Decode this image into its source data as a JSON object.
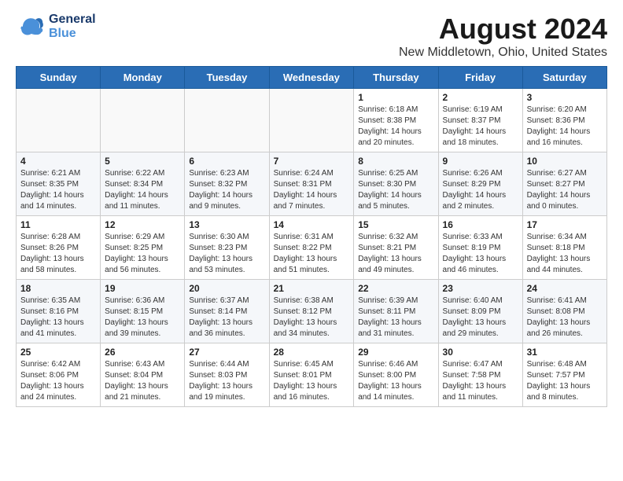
{
  "logo": {
    "line1": "General",
    "line2": "Blue"
  },
  "title": "August 2024",
  "subtitle": "New Middletown, Ohio, United States",
  "days_of_week": [
    "Sunday",
    "Monday",
    "Tuesday",
    "Wednesday",
    "Thursday",
    "Friday",
    "Saturday"
  ],
  "weeks": [
    [
      {
        "day": "",
        "info": ""
      },
      {
        "day": "",
        "info": ""
      },
      {
        "day": "",
        "info": ""
      },
      {
        "day": "",
        "info": ""
      },
      {
        "day": "1",
        "info": "Sunrise: 6:18 AM\nSunset: 8:38 PM\nDaylight: 14 hours\nand 20 minutes."
      },
      {
        "day": "2",
        "info": "Sunrise: 6:19 AM\nSunset: 8:37 PM\nDaylight: 14 hours\nand 18 minutes."
      },
      {
        "day": "3",
        "info": "Sunrise: 6:20 AM\nSunset: 8:36 PM\nDaylight: 14 hours\nand 16 minutes."
      }
    ],
    [
      {
        "day": "4",
        "info": "Sunrise: 6:21 AM\nSunset: 8:35 PM\nDaylight: 14 hours\nand 14 minutes."
      },
      {
        "day": "5",
        "info": "Sunrise: 6:22 AM\nSunset: 8:34 PM\nDaylight: 14 hours\nand 11 minutes."
      },
      {
        "day": "6",
        "info": "Sunrise: 6:23 AM\nSunset: 8:32 PM\nDaylight: 14 hours\nand 9 minutes."
      },
      {
        "day": "7",
        "info": "Sunrise: 6:24 AM\nSunset: 8:31 PM\nDaylight: 14 hours\nand 7 minutes."
      },
      {
        "day": "8",
        "info": "Sunrise: 6:25 AM\nSunset: 8:30 PM\nDaylight: 14 hours\nand 5 minutes."
      },
      {
        "day": "9",
        "info": "Sunrise: 6:26 AM\nSunset: 8:29 PM\nDaylight: 14 hours\nand 2 minutes."
      },
      {
        "day": "10",
        "info": "Sunrise: 6:27 AM\nSunset: 8:27 PM\nDaylight: 14 hours\nand 0 minutes."
      }
    ],
    [
      {
        "day": "11",
        "info": "Sunrise: 6:28 AM\nSunset: 8:26 PM\nDaylight: 13 hours\nand 58 minutes."
      },
      {
        "day": "12",
        "info": "Sunrise: 6:29 AM\nSunset: 8:25 PM\nDaylight: 13 hours\nand 56 minutes."
      },
      {
        "day": "13",
        "info": "Sunrise: 6:30 AM\nSunset: 8:23 PM\nDaylight: 13 hours\nand 53 minutes."
      },
      {
        "day": "14",
        "info": "Sunrise: 6:31 AM\nSunset: 8:22 PM\nDaylight: 13 hours\nand 51 minutes."
      },
      {
        "day": "15",
        "info": "Sunrise: 6:32 AM\nSunset: 8:21 PM\nDaylight: 13 hours\nand 49 minutes."
      },
      {
        "day": "16",
        "info": "Sunrise: 6:33 AM\nSunset: 8:19 PM\nDaylight: 13 hours\nand 46 minutes."
      },
      {
        "day": "17",
        "info": "Sunrise: 6:34 AM\nSunset: 8:18 PM\nDaylight: 13 hours\nand 44 minutes."
      }
    ],
    [
      {
        "day": "18",
        "info": "Sunrise: 6:35 AM\nSunset: 8:16 PM\nDaylight: 13 hours\nand 41 minutes."
      },
      {
        "day": "19",
        "info": "Sunrise: 6:36 AM\nSunset: 8:15 PM\nDaylight: 13 hours\nand 39 minutes."
      },
      {
        "day": "20",
        "info": "Sunrise: 6:37 AM\nSunset: 8:14 PM\nDaylight: 13 hours\nand 36 minutes."
      },
      {
        "day": "21",
        "info": "Sunrise: 6:38 AM\nSunset: 8:12 PM\nDaylight: 13 hours\nand 34 minutes."
      },
      {
        "day": "22",
        "info": "Sunrise: 6:39 AM\nSunset: 8:11 PM\nDaylight: 13 hours\nand 31 minutes."
      },
      {
        "day": "23",
        "info": "Sunrise: 6:40 AM\nSunset: 8:09 PM\nDaylight: 13 hours\nand 29 minutes."
      },
      {
        "day": "24",
        "info": "Sunrise: 6:41 AM\nSunset: 8:08 PM\nDaylight: 13 hours\nand 26 minutes."
      }
    ],
    [
      {
        "day": "25",
        "info": "Sunrise: 6:42 AM\nSunset: 8:06 PM\nDaylight: 13 hours\nand 24 minutes."
      },
      {
        "day": "26",
        "info": "Sunrise: 6:43 AM\nSunset: 8:04 PM\nDaylight: 13 hours\nand 21 minutes."
      },
      {
        "day": "27",
        "info": "Sunrise: 6:44 AM\nSunset: 8:03 PM\nDaylight: 13 hours\nand 19 minutes."
      },
      {
        "day": "28",
        "info": "Sunrise: 6:45 AM\nSunset: 8:01 PM\nDaylight: 13 hours\nand 16 minutes."
      },
      {
        "day": "29",
        "info": "Sunrise: 6:46 AM\nSunset: 8:00 PM\nDaylight: 13 hours\nand 14 minutes."
      },
      {
        "day": "30",
        "info": "Sunrise: 6:47 AM\nSunset: 7:58 PM\nDaylight: 13 hours\nand 11 minutes."
      },
      {
        "day": "31",
        "info": "Sunrise: 6:48 AM\nSunset: 7:57 PM\nDaylight: 13 hours\nand 8 minutes."
      }
    ]
  ]
}
